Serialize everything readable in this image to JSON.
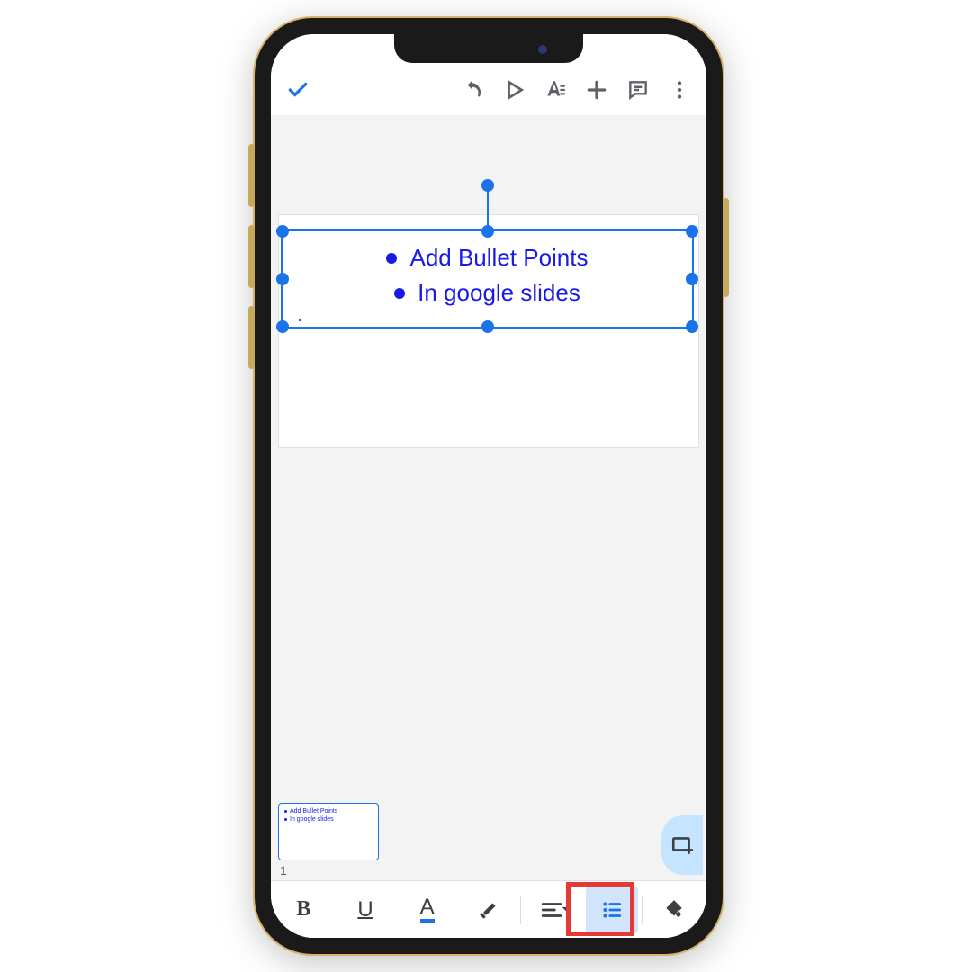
{
  "colors": {
    "accent": "#1a73e8",
    "bullet_text": "#1a1ae6",
    "highlight": "#e53935"
  },
  "textbox": {
    "bullets": [
      "Add Bullet Points",
      "In google slides"
    ]
  },
  "thumbnail": {
    "lines": [
      "Add Bullet Points",
      "In google slides"
    ],
    "number": "1"
  },
  "format_bar": {
    "bold": "B",
    "underline": "U",
    "text_color": "A"
  },
  "icons": {
    "check": "check",
    "undo": "undo",
    "play": "play",
    "text_format": "text-format",
    "add": "add",
    "comment": "comment",
    "more": "more-vert",
    "new_slide": "new-slide",
    "highlighter": "highlighter",
    "align": "align-left",
    "bulleted_list": "bulleted-list",
    "fill": "paint-bucket"
  }
}
